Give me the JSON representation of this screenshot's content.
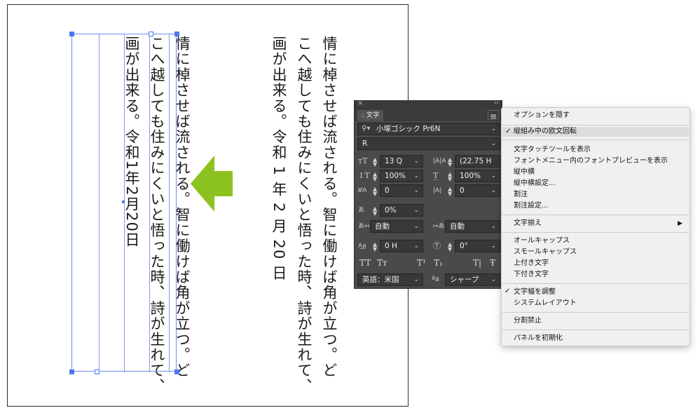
{
  "document": {
    "right_column": {
      "line1": "情に棹させば流される。智に働けば角が立つ。ど",
      "line2": "こへ越しても住みにくいと悟った時、詩が生れて、",
      "line3": "画が出来る。令和 1 年 2 月 20 日"
    },
    "left_column": {
      "line1": "情に棹させば流される。智に働けば角が立つ。ど",
      "line2": "こへ越しても住みにくいと悟った時、詩が生れて、",
      "line3": "画が出来る。令和1年2月20日"
    },
    "arrow_color": "#8cc21f",
    "selection_color": "#4e78f0"
  },
  "panel": {
    "close": "×",
    "collapse": "‹‹",
    "tab_label": "文字",
    "menu_icon": "≡",
    "font_family": "小塚ゴシック Pr6N",
    "font_style": "R",
    "font_size": "13 Q",
    "leading": "(22.75 H",
    "vertical_scale": "100%",
    "horizontal_scale": "100%",
    "kerning": "0",
    "tracking": "0",
    "tsume": "0%",
    "aki_before": "自動",
    "aki_after": "自動",
    "baseline_shift": "0 H",
    "rotation": "0°",
    "glyphs": [
      "TT",
      "Tт",
      "T¹",
      "T₁",
      "T|",
      "Ŧ"
    ],
    "language": "英語：米国",
    "antialias_icon": "ªa",
    "antialias": "シャープ"
  },
  "menu": {
    "items": [
      {
        "label": "オプションを隠す"
      },
      {
        "label": "縦組み中の欧文回転",
        "checked": true,
        "highlighted": true
      },
      {
        "label": "文字タッチツールを表示"
      },
      {
        "label": "フォントメニュー内のフォントプレビューを表示"
      },
      {
        "label": "縦中横"
      },
      {
        "label": "縦中横設定..."
      },
      {
        "label": "割注"
      },
      {
        "label": "割注設定..."
      },
      {
        "label": "文字揃え",
        "submenu": "▶"
      },
      {
        "label": "オールキャップス"
      },
      {
        "label": "スモールキャップス"
      },
      {
        "label": "上付き文字"
      },
      {
        "label": "下付き文字"
      },
      {
        "label": "文字幅を調整",
        "checked": true
      },
      {
        "label": "システムレイアウト"
      },
      {
        "label": "分割禁止"
      },
      {
        "label": "パネルを初期化"
      }
    ],
    "check_mark": "✓"
  }
}
